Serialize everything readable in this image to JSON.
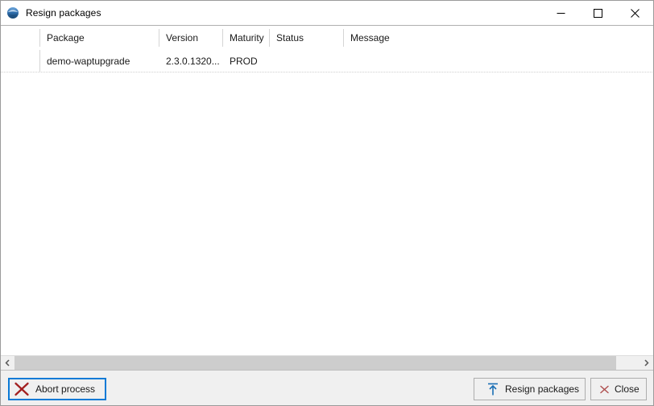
{
  "window": {
    "title": "Resign packages",
    "icon": "wapt-globe-icon",
    "controls": [
      {
        "name": "minimize-button",
        "glyph": "minimize-icon"
      },
      {
        "name": "maximize-button",
        "glyph": "maximize-icon"
      },
      {
        "name": "close-button",
        "glyph": "close-icon"
      }
    ]
  },
  "grid": {
    "columns": [
      {
        "key": "selector",
        "label": ""
      },
      {
        "key": "package",
        "label": "Package"
      },
      {
        "key": "version",
        "label": "Version"
      },
      {
        "key": "maturity",
        "label": "Maturity"
      },
      {
        "key": "status",
        "label": "Status"
      },
      {
        "key": "message",
        "label": "Message"
      }
    ],
    "rows": [
      {
        "selector": "",
        "package": "demo-waptupgrade",
        "version": "2.3.0.1320...",
        "maturity": "PROD",
        "status": "",
        "message": ""
      }
    ]
  },
  "scrollbar": {
    "left_arrow": "chevron-left-icon",
    "right_arrow": "chevron-right-icon"
  },
  "buttons": {
    "abort": {
      "label": "Abort process",
      "icon": "red-x-icon"
    },
    "resign": {
      "label": "Resign packages",
      "icon": "upload-arrow-icon"
    },
    "close": {
      "label": "Close",
      "icon": "red-x-small-icon"
    }
  },
  "colors": {
    "focus_blue": "#0a7ad6",
    "accent_blue": "#1a6fb5",
    "danger_red": "#a32020",
    "close_red": "#b05252",
    "panel_gray": "#f0f0f0",
    "scroll_thumb": "#cdcdcd"
  }
}
